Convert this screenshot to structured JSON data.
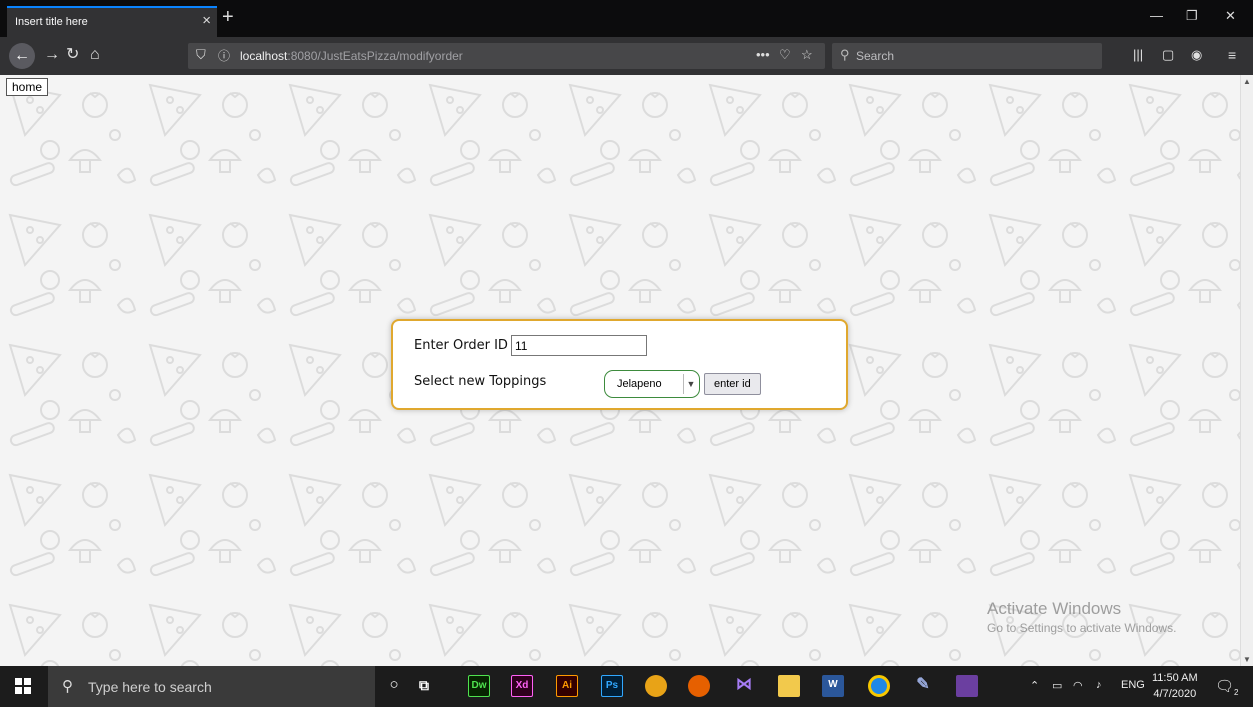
{
  "browser": {
    "tab_title": "Insert title here",
    "tab_close": "×",
    "new_tab": "+",
    "url_host": "localhost",
    "url_path": ":8080/JustEatsPizza/modifyorder",
    "search_placeholder": "Search",
    "page_actions": "•••"
  },
  "page": {
    "home_link": "home",
    "form": {
      "order_id_label": "Enter Order ID",
      "order_id_value": "11",
      "toppings_label": "Select new Toppings",
      "toppings_selected": "Jelapeno",
      "submit_label": "enter id"
    },
    "watermark": {
      "title": "Activate Windows",
      "subtitle": "Go to Settings to activate Windows."
    }
  },
  "taskbar": {
    "search_placeholder": "Type here to search",
    "apps": [
      "Dw",
      "Xd",
      "Ai",
      "Ps"
    ],
    "language": "ENG",
    "time": "11:50 AM",
    "date": "4/7/2020",
    "notification_count": "2"
  },
  "colors": {
    "card_border": "#e0a82e",
    "select_border": "#3d8b3d",
    "tab_accent": "#0a84ff"
  }
}
